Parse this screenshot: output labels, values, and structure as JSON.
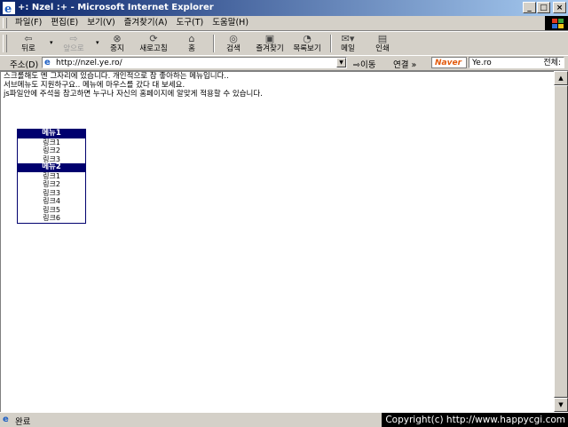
{
  "window": {
    "title": "+: Nzel :+ - Microsoft Internet Explorer",
    "minimize": "_",
    "maximize": "□",
    "close": "×"
  },
  "menubar": {
    "items": [
      "파일(F)",
      "편집(E)",
      "보기(V)",
      "즐겨찾기(A)",
      "도구(T)",
      "도움말(H)"
    ]
  },
  "toolbar": {
    "back": "뒤로",
    "forward": "앞으로",
    "stop": "중지",
    "refresh": "새로고침",
    "home": "홈",
    "search": "검색",
    "favorites": "즐겨찾기",
    "history": "목록보기",
    "mail": "메일",
    "print": "인쇄"
  },
  "address": {
    "label": "주소(D)",
    "url": "http://nzel.ye.ro/",
    "go": "이동",
    "links": "연결 »",
    "naver": "Naver",
    "search_value": "Ye.ro",
    "search_all": "전체:"
  },
  "content": {
    "lines": [
      "스크롤해도 멘 그자리에 있습니다. 개인적으로 참 좋아하는 메뉴입니다..",
      "서브메뉴도 지원하구요.. 메뉴에 마우스를 갔다 대 보세요.",
      "js파일안에 주석을 참고하면 누구나 자신의 홈페이지에 알맞게 적용할 수 있습니다."
    ],
    "menu": [
      {
        "title": "메뉴1",
        "links": [
          "링크1",
          "링크2",
          "링크3"
        ]
      },
      {
        "title": "메뉴2",
        "links": [
          "링크1",
          "링크2",
          "링크3",
          "링크4",
          "링크5",
          "링크6"
        ]
      }
    ]
  },
  "status": {
    "text": "완료",
    "copyright": "Copyright(c) http://www.happycgi.com"
  }
}
